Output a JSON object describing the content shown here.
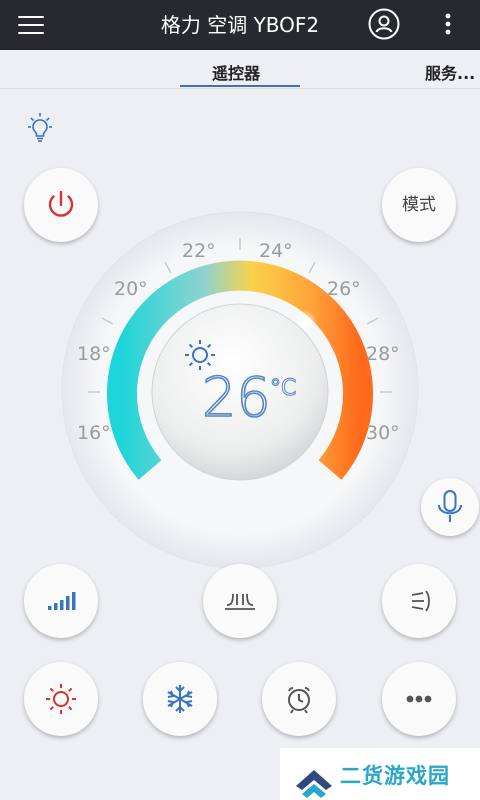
{
  "header": {
    "title": "格力 空调 YBOF2",
    "menu_icon": "hamburger-menu-icon",
    "user_icon": "user-icon",
    "more_icon": "vertical-dots-icon"
  },
  "tabs": [
    {
      "label": "遥控器",
      "active": true
    },
    {
      "label": "服务..."
    }
  ],
  "controls": {
    "mode_label": "模式",
    "power_icon": "power-icon",
    "voice_icon": "microphone-icon",
    "light_icon": "light-bulb-icon"
  },
  "thermostat": {
    "temperature": "26",
    "unit": "°C",
    "mode_icon": "sun-icon",
    "scale_left": [
      "16°",
      "18°",
      "20°",
      "22°"
    ],
    "scale_right": [
      "24°",
      "26°",
      "28°",
      "30°"
    ]
  },
  "bottom_buttons": {
    "row1": [
      "fan-speed-icon",
      "swing-vertical-icon",
      "swing-horizontal-icon"
    ],
    "row2": [
      "heat-icon",
      "cool-icon",
      "timer-icon",
      "more-icon"
    ]
  },
  "watermark": {
    "text": "二货游戏园",
    "logo": "chevron-logo-icon"
  },
  "colors": {
    "header_bg": "#262a30",
    "accent": "#3a73c4",
    "power_red": "#d8312f",
    "gauge_cold": "#1fd5d9",
    "gauge_warm": "#f9c93c",
    "gauge_hot": "#ff6a1c"
  }
}
